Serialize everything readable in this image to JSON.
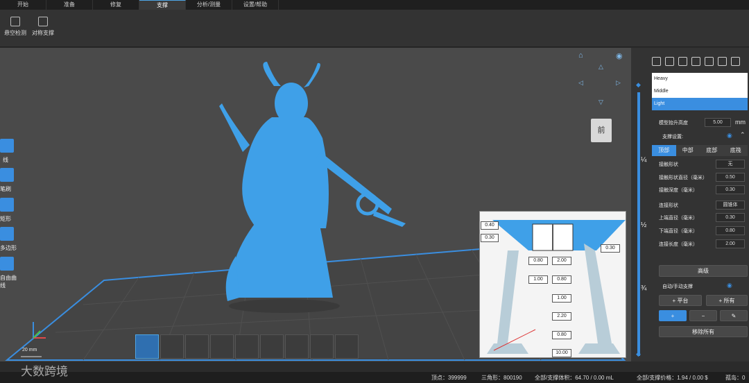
{
  "menu": {
    "tabs": [
      "开始",
      "准备",
      "修复",
      "支撑",
      "分析/测量",
      "设置/帮助"
    ],
    "active_index": 3
  },
  "toolbar": {
    "tools": [
      "悬空检测",
      "对称支撑"
    ]
  },
  "left_tools": {
    "items": [
      "线",
      "笔刷",
      "矩形",
      "多边形",
      "自由曲线"
    ]
  },
  "view_cube": {
    "face_label": "前"
  },
  "scale_label": "20 mm",
  "density": {
    "items": [
      "Heavy",
      "Middle",
      "Light"
    ],
    "selected_index": 2
  },
  "lift": {
    "label": "模型抬升高度",
    "value": "5.00",
    "unit": "mm"
  },
  "support_settings": {
    "title": "支撑设置:",
    "tabs": [
      "顶部",
      "中部",
      "底部",
      "底筏"
    ],
    "active_tab": 0,
    "rows": [
      {
        "label": "接触形状",
        "value": "无"
      },
      {
        "label": "接触形状直径（毫米）",
        "value": "0.50"
      },
      {
        "label": "接触深度（毫米）",
        "value": "0.30"
      },
      {
        "label": "连接形状",
        "value": "圆锥体"
      },
      {
        "label": "上端直径（毫米）",
        "value": "0.30"
      },
      {
        "label": "下端直径（毫米）",
        "value": "0.80"
      },
      {
        "label": "连接长度（毫米）",
        "value": "2.00"
      }
    ],
    "advanced_button": "高级"
  },
  "auto_manual": {
    "title": "自动/手动支撑",
    "platform_button": "+ 平台",
    "all_button": "+ 所有",
    "remove_all_button": "移除所有"
  },
  "slider": {
    "fractions": [
      "¼",
      "½",
      "¾"
    ]
  },
  "diagram": {
    "values": [
      "0.40",
      "0.30",
      "0.30",
      "0.80",
      "2.00",
      "1.00",
      "0.80",
      "1.00",
      "2.20",
      "0.80",
      "10.00"
    ]
  },
  "status": {
    "vertices": "顶点：399999",
    "triangles": "三角形：800190",
    "volume": "全部/支撑体积：64.70 / 0.00 mL",
    "price": "全部/支撑价格：1.94 / 0.00 $",
    "islands": "孤岛：0"
  },
  "watermark": "大数跨境",
  "colors": {
    "accent": "#3a8ee0",
    "model": "#3fa0e8"
  }
}
